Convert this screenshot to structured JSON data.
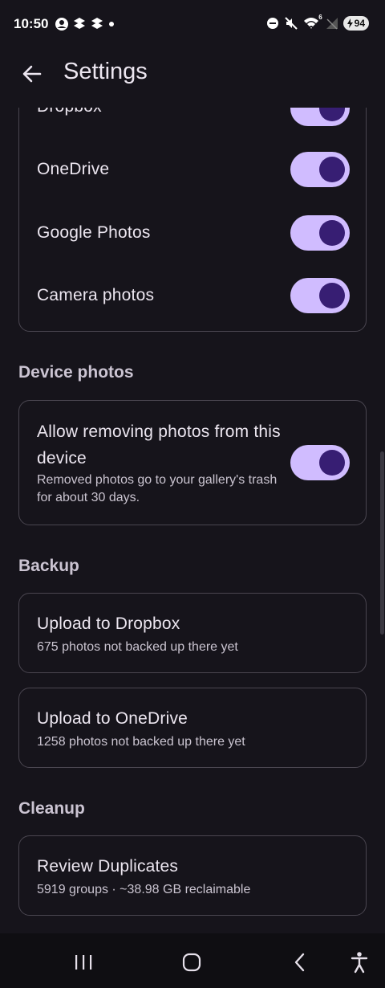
{
  "status": {
    "time": "10:50",
    "battery": "94",
    "network": "6"
  },
  "app_bar": {
    "title": "Settings"
  },
  "sources": {
    "items": [
      {
        "label": "Dropbox",
        "enabled": true
      },
      {
        "label": "OneDrive",
        "enabled": true
      },
      {
        "label": "Google Photos",
        "enabled": true
      },
      {
        "label": "Camera photos",
        "enabled": true
      }
    ]
  },
  "device_photos": {
    "header": "Device photos",
    "title": "Allow removing photos from this device",
    "subtitle": "Removed photos go to your gallery's trash for about 30 days.",
    "enabled": true
  },
  "backup": {
    "header": "Backup",
    "items": [
      {
        "title": "Upload to Dropbox",
        "subtitle": "675 photos not backed up there yet"
      },
      {
        "title": "Upload to OneDrive",
        "subtitle": "1258 photos not backed up there yet"
      }
    ]
  },
  "cleanup": {
    "header": "Cleanup",
    "items": [
      {
        "title": "Review Duplicates",
        "subtitle": "5919 groups · ~38.98 GB reclaimable"
      }
    ]
  },
  "colors": {
    "background": "#16141b",
    "toggle_track": "#d0bcff",
    "toggle_thumb": "#371e73",
    "card_border": "#4a4650"
  },
  "icons": {
    "back": "arrow-left-icon",
    "nav_recents": "recents-icon",
    "nav_home": "home-icon",
    "nav_back": "chevron-left-icon",
    "nav_accessibility": "accessibility-icon"
  }
}
